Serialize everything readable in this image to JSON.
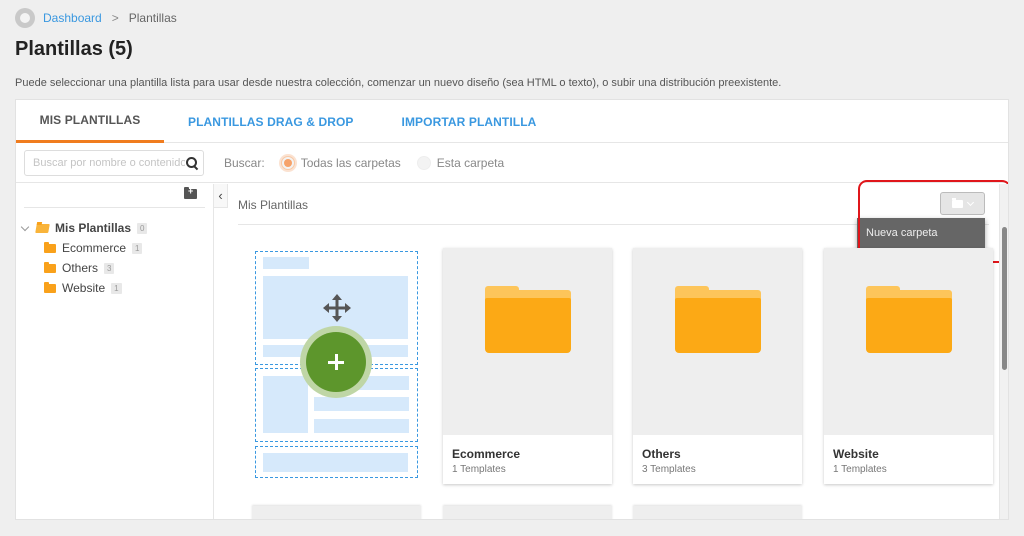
{
  "breadcrumb": {
    "home_icon": "home-icon",
    "items": [
      "Dashboard",
      "Plantillas"
    ],
    "separator": ">"
  },
  "page": {
    "title": "Plantillas (5)",
    "description": "Puede seleccionar una plantilla lista para usar desde nuestra colección, comenzar un nuevo diseño (sea HTML o texto), o subir una distribución preexistente."
  },
  "tabs": [
    {
      "label": "MIS PLANTILLAS",
      "active": true
    },
    {
      "label": "PLANTILLAS DRAG & DROP",
      "active": false
    },
    {
      "label": "IMPORTAR PLANTILLA",
      "active": false
    }
  ],
  "toolbar": {
    "search_placeholder": "Buscar por nombre o contenido",
    "search_value": "",
    "search_label": "Buscar:",
    "scope_options": [
      {
        "label": "Todas las carpetas",
        "selected": true
      },
      {
        "label": "Esta carpeta",
        "selected": false
      }
    ]
  },
  "sidebar": {
    "root": {
      "label": "Mis Plantillas",
      "count": "0",
      "expanded": true
    },
    "folders": [
      {
        "label": "Ecommerce",
        "count": "1"
      },
      {
        "label": "Others",
        "count": "3"
      },
      {
        "label": "Website",
        "count": "1"
      }
    ]
  },
  "main": {
    "title": "Mis Plantillas",
    "folder_menu": {
      "items": [
        "Nueva carpeta"
      ]
    },
    "cards": [
      {
        "name": "Ecommerce",
        "count": "1 Templates"
      },
      {
        "name": "Others",
        "count": "3 Templates"
      },
      {
        "name": "Website",
        "count": "1 Templates"
      }
    ]
  },
  "colors": {
    "accent_orange": "#f07c1e",
    "link_blue": "#3a98e0",
    "folder_yellow": "#fca915",
    "add_green": "#5d962c",
    "highlight_red": "#e0161b"
  }
}
